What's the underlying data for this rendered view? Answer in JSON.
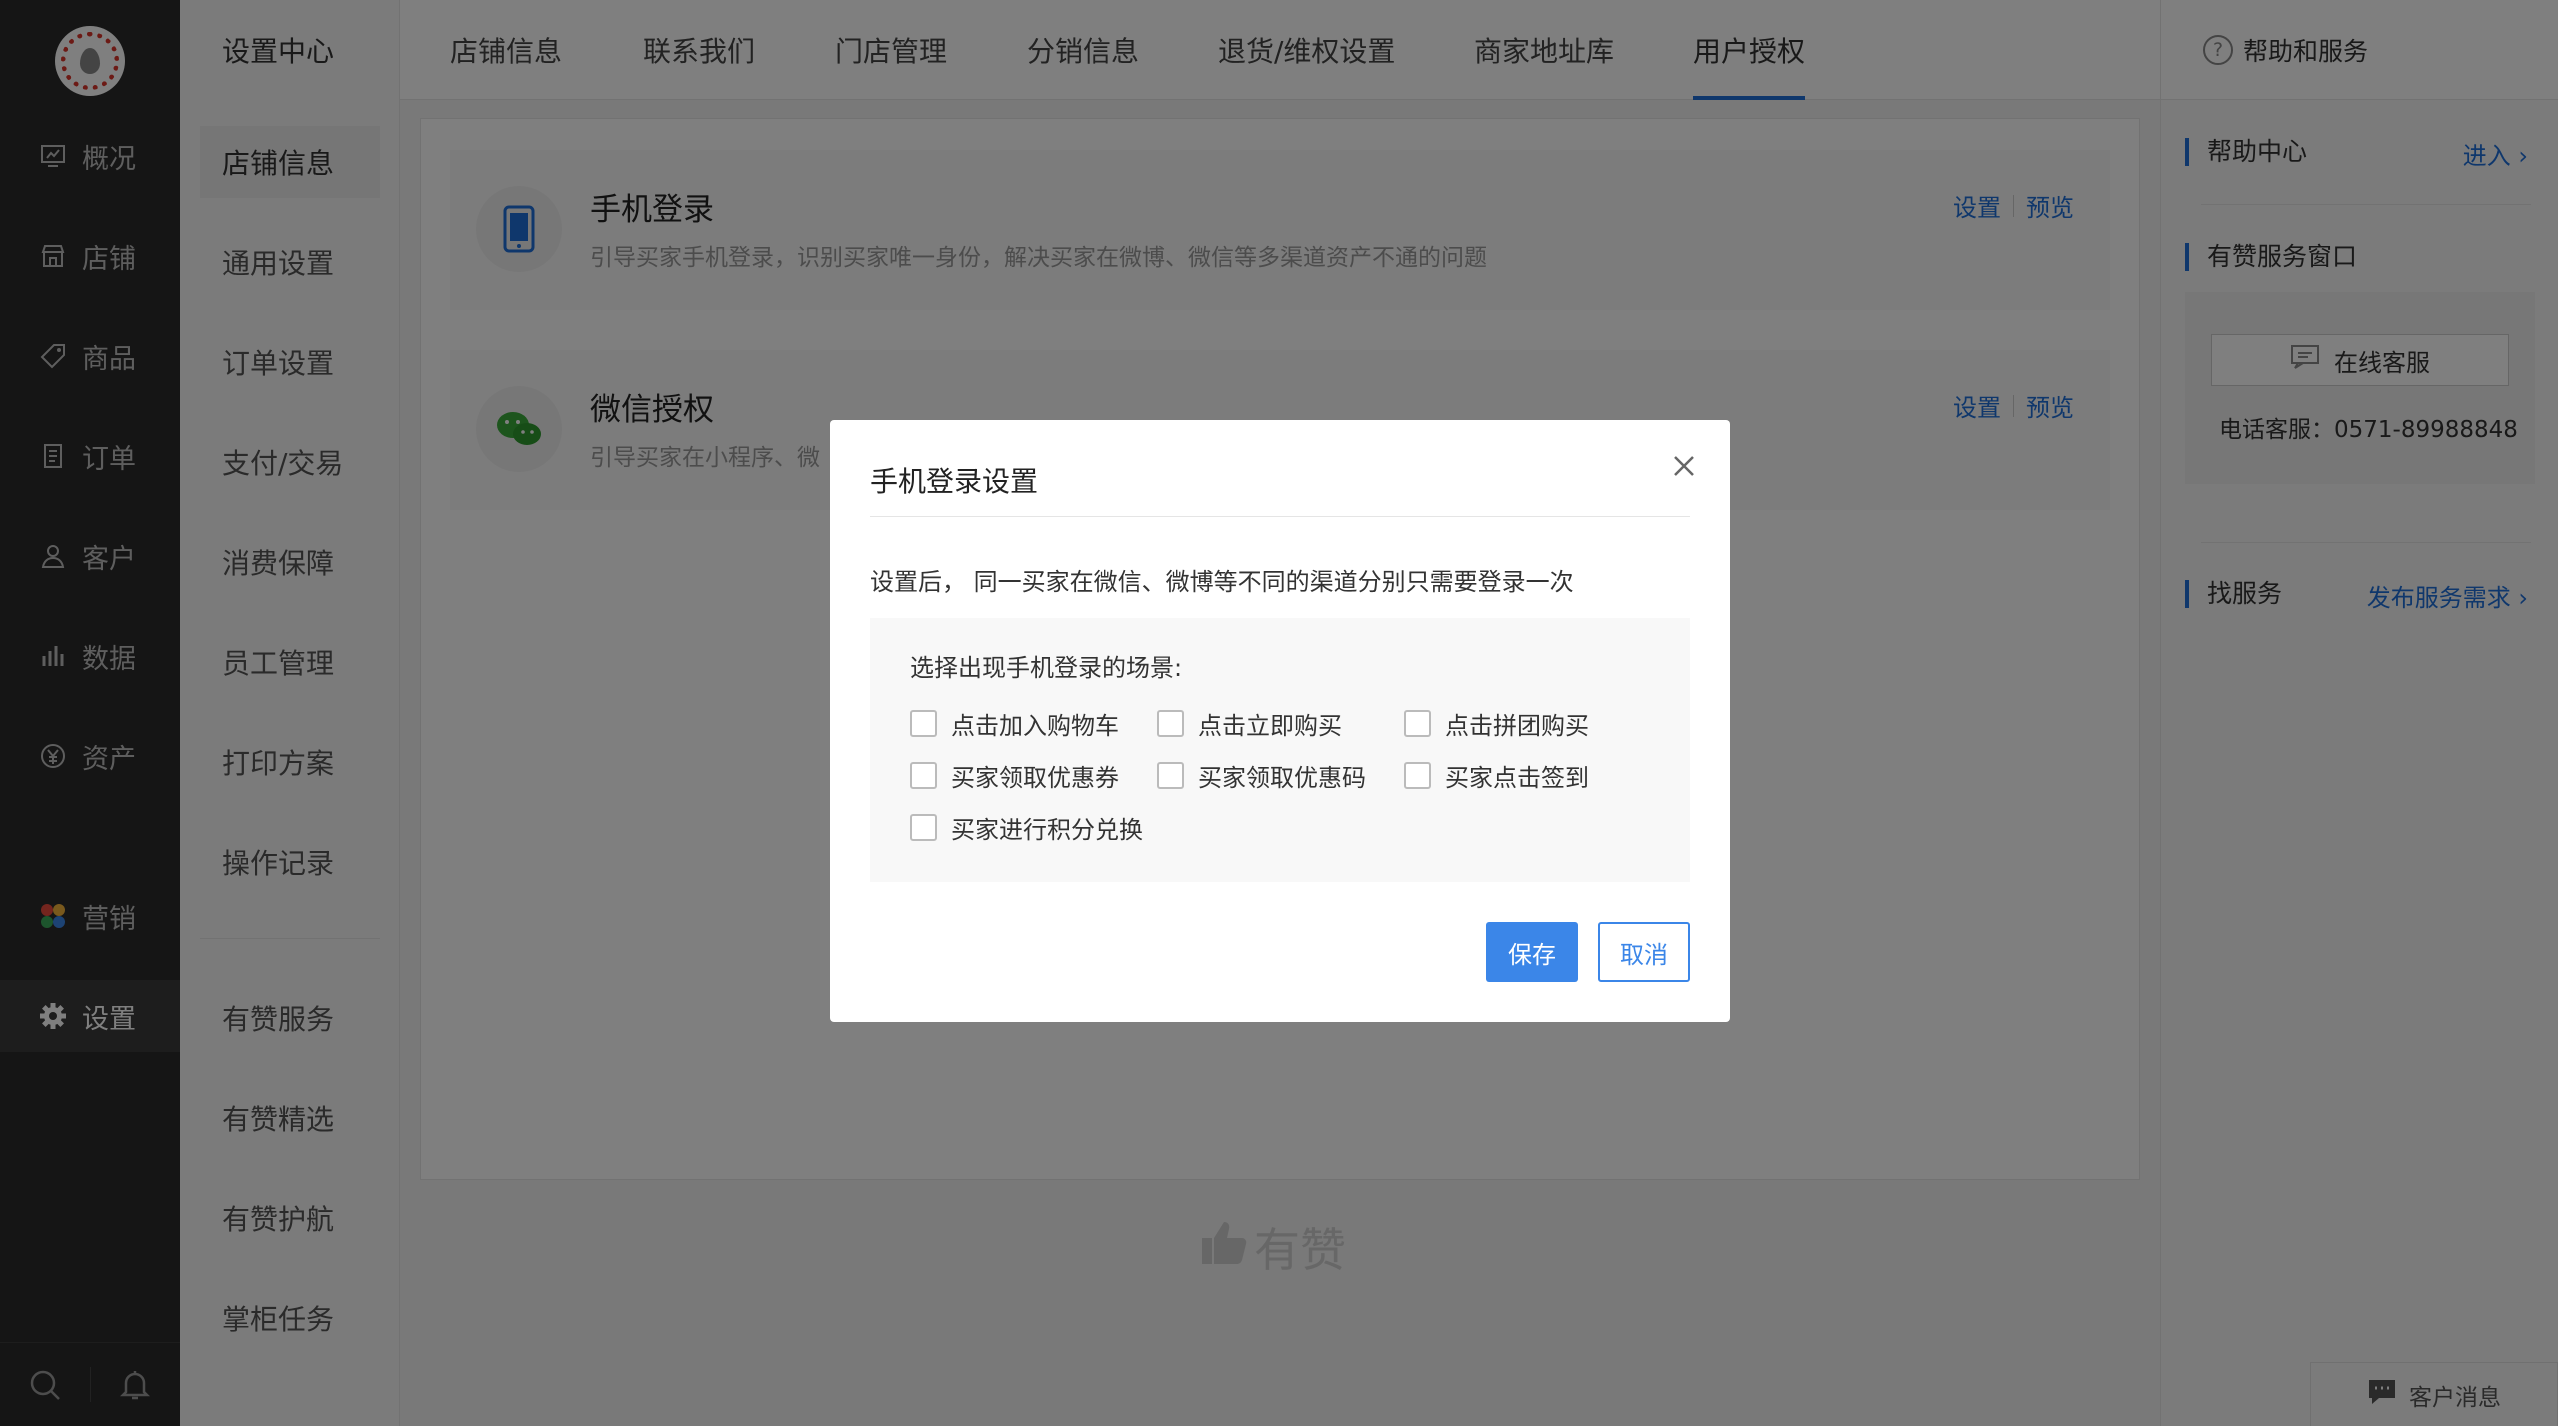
{
  "mainnav": {
    "items": [
      {
        "label": "概况",
        "icon": "overview-icon"
      },
      {
        "label": "店铺",
        "icon": "store-icon"
      },
      {
        "label": "商品",
        "icon": "tag-icon"
      },
      {
        "label": "订单",
        "icon": "order-icon"
      },
      {
        "label": "客户",
        "icon": "user-icon"
      },
      {
        "label": "数据",
        "icon": "chart-icon"
      },
      {
        "label": "资产",
        "icon": "yuan-icon"
      },
      {
        "label": "营销",
        "icon": "marketing-icon"
      },
      {
        "label": "设置",
        "icon": "gear-icon"
      }
    ]
  },
  "subnav": {
    "title": "设置中心",
    "items": [
      "店铺信息",
      "通用设置",
      "订单设置",
      "支付/交易",
      "消费保障",
      "员工管理",
      "打印方案",
      "操作记录"
    ],
    "extra": [
      "有赞服务",
      "有赞精选",
      "有赞护航",
      "掌柜任务"
    ]
  },
  "tabs": [
    "店铺信息",
    "联系我们",
    "门店管理",
    "分销信息",
    "退货/维权设置",
    "商家地址库",
    "用户授权"
  ],
  "cards": [
    {
      "title": "手机登录",
      "desc": "引导买家手机登录，识别买家唯一身份，解决买家在微博、微信等多渠道资产不通的问题",
      "link1": "设置",
      "link2": "预览"
    },
    {
      "title": "微信授权",
      "desc": "引导买家在小程序、微",
      "link1": "设置",
      "link2": "预览"
    }
  ],
  "brand": "有赞",
  "help": {
    "header": "帮助和服务",
    "help_center": "帮助中心",
    "enter": "进入",
    "service_window": "有赞服务窗口",
    "online_service": "在线客服",
    "phone": "电话客服：0571-89988848",
    "find_service": "找服务",
    "publish": "发布服务需求",
    "messages": "客户消息"
  },
  "modal": {
    "title": "手机登录设置",
    "desc": "设置后， 同一买家在微信、微博等不同的渠道分别只需要登录一次",
    "box_title": "选择出现手机登录的场景:",
    "options": [
      "点击加入购物车",
      "点击立即购买",
      "点击拼团购买",
      "买家领取优惠券",
      "买家领取优惠码",
      "买家点击签到",
      "买家进行积分兑换"
    ],
    "save": "保存",
    "cancel": "取消"
  },
  "colors": {
    "accent": "#1e6fd9",
    "primary_button": "#3b86e8",
    "nav_bg": "#2b2b2b"
  }
}
